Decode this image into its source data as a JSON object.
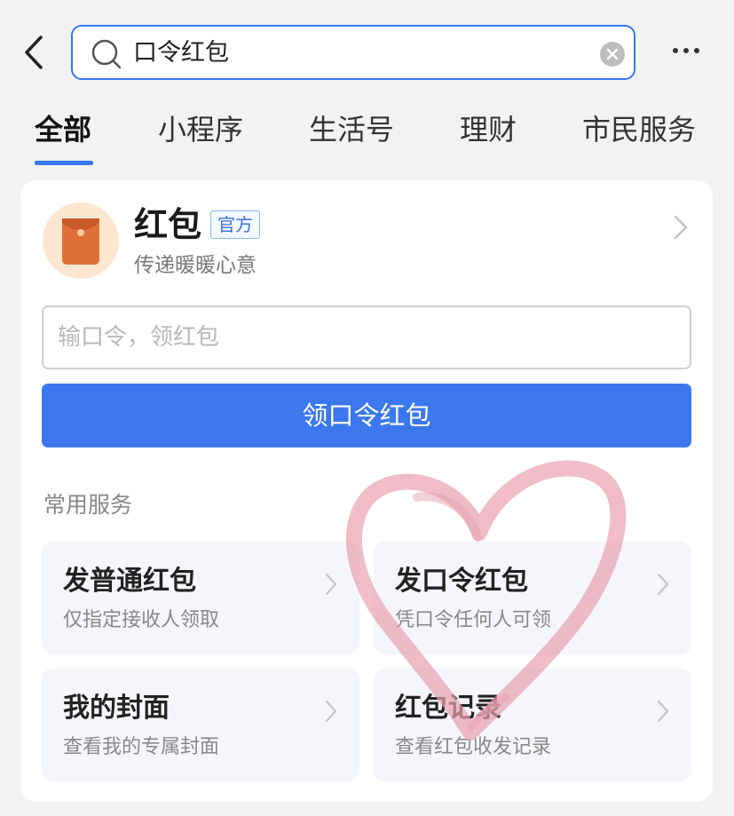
{
  "search": {
    "query": "口令红包"
  },
  "tabs": [
    {
      "label": "全部"
    },
    {
      "label": "小程序"
    },
    {
      "label": "生活号"
    },
    {
      "label": "理财"
    },
    {
      "label": "市民服务"
    }
  ],
  "card": {
    "title": "红包",
    "badge": "官方",
    "subtitle": "传递暖暖心意",
    "input_placeholder": "输口令，领红包",
    "claim_button": "领口令红包",
    "section_title": "常用服务",
    "services": [
      {
        "title": "发普通红包",
        "subtitle": "仅指定接收人领取"
      },
      {
        "title": "发口令红包",
        "subtitle": "凭口令任何人可领"
      },
      {
        "title": "我的封面",
        "subtitle": "查看我的专属封面"
      },
      {
        "title": "红包记录",
        "subtitle": "查看红包收发记录"
      }
    ]
  },
  "colors": {
    "accent": "#3b78ee",
    "logo_bg": "#fbe7d0",
    "envelope": "#e0703a",
    "heart": "#e8a0b0"
  },
  "icons": [
    "back-arrow-icon",
    "search-icon",
    "clear-icon",
    "more-icon",
    "red-envelope-icon",
    "chevron-right-icon",
    "heart-drawing"
  ]
}
